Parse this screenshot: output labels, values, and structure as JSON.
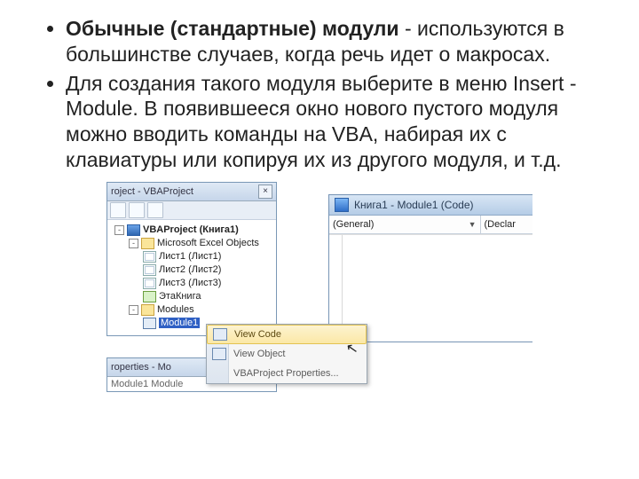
{
  "bullets": [
    {
      "bold": "Обычные (стандартные) модули",
      "rest": " - используются в большинстве случаев, когда речь идет о макросах."
    },
    {
      "bold": "",
      "rest": "Для создания такого модуля выберите в меню Insert - Module. В появившееся окно нового пустого модуля можно вводить команды на VBA, набирая их с клавиатуры или копируя их из другого модуля, и т.д."
    }
  ],
  "projectWindow": {
    "title": "roject - VBAProject",
    "root": "VBAProject (Книга1)",
    "folder1": "Microsoft Excel Objects",
    "sheets": [
      "Лист1 (Лист1)",
      "Лист2 (Лист2)",
      "Лист3 (Лист3)"
    ],
    "thisWb": "ЭтаКнига",
    "folder2": "Modules",
    "module": "Module1"
  },
  "propertiesWindow": {
    "title": "roperties - Mo",
    "row": "Module1  Module"
  },
  "codeWindow": {
    "title": "Книга1 - Module1 (Code)",
    "ddLeft": "(General)",
    "ddRight": "(Declar"
  },
  "contextMenu": {
    "items": [
      "View Code",
      "View Object",
      "VBAProject Properties..."
    ],
    "hoverIndex": 0
  }
}
